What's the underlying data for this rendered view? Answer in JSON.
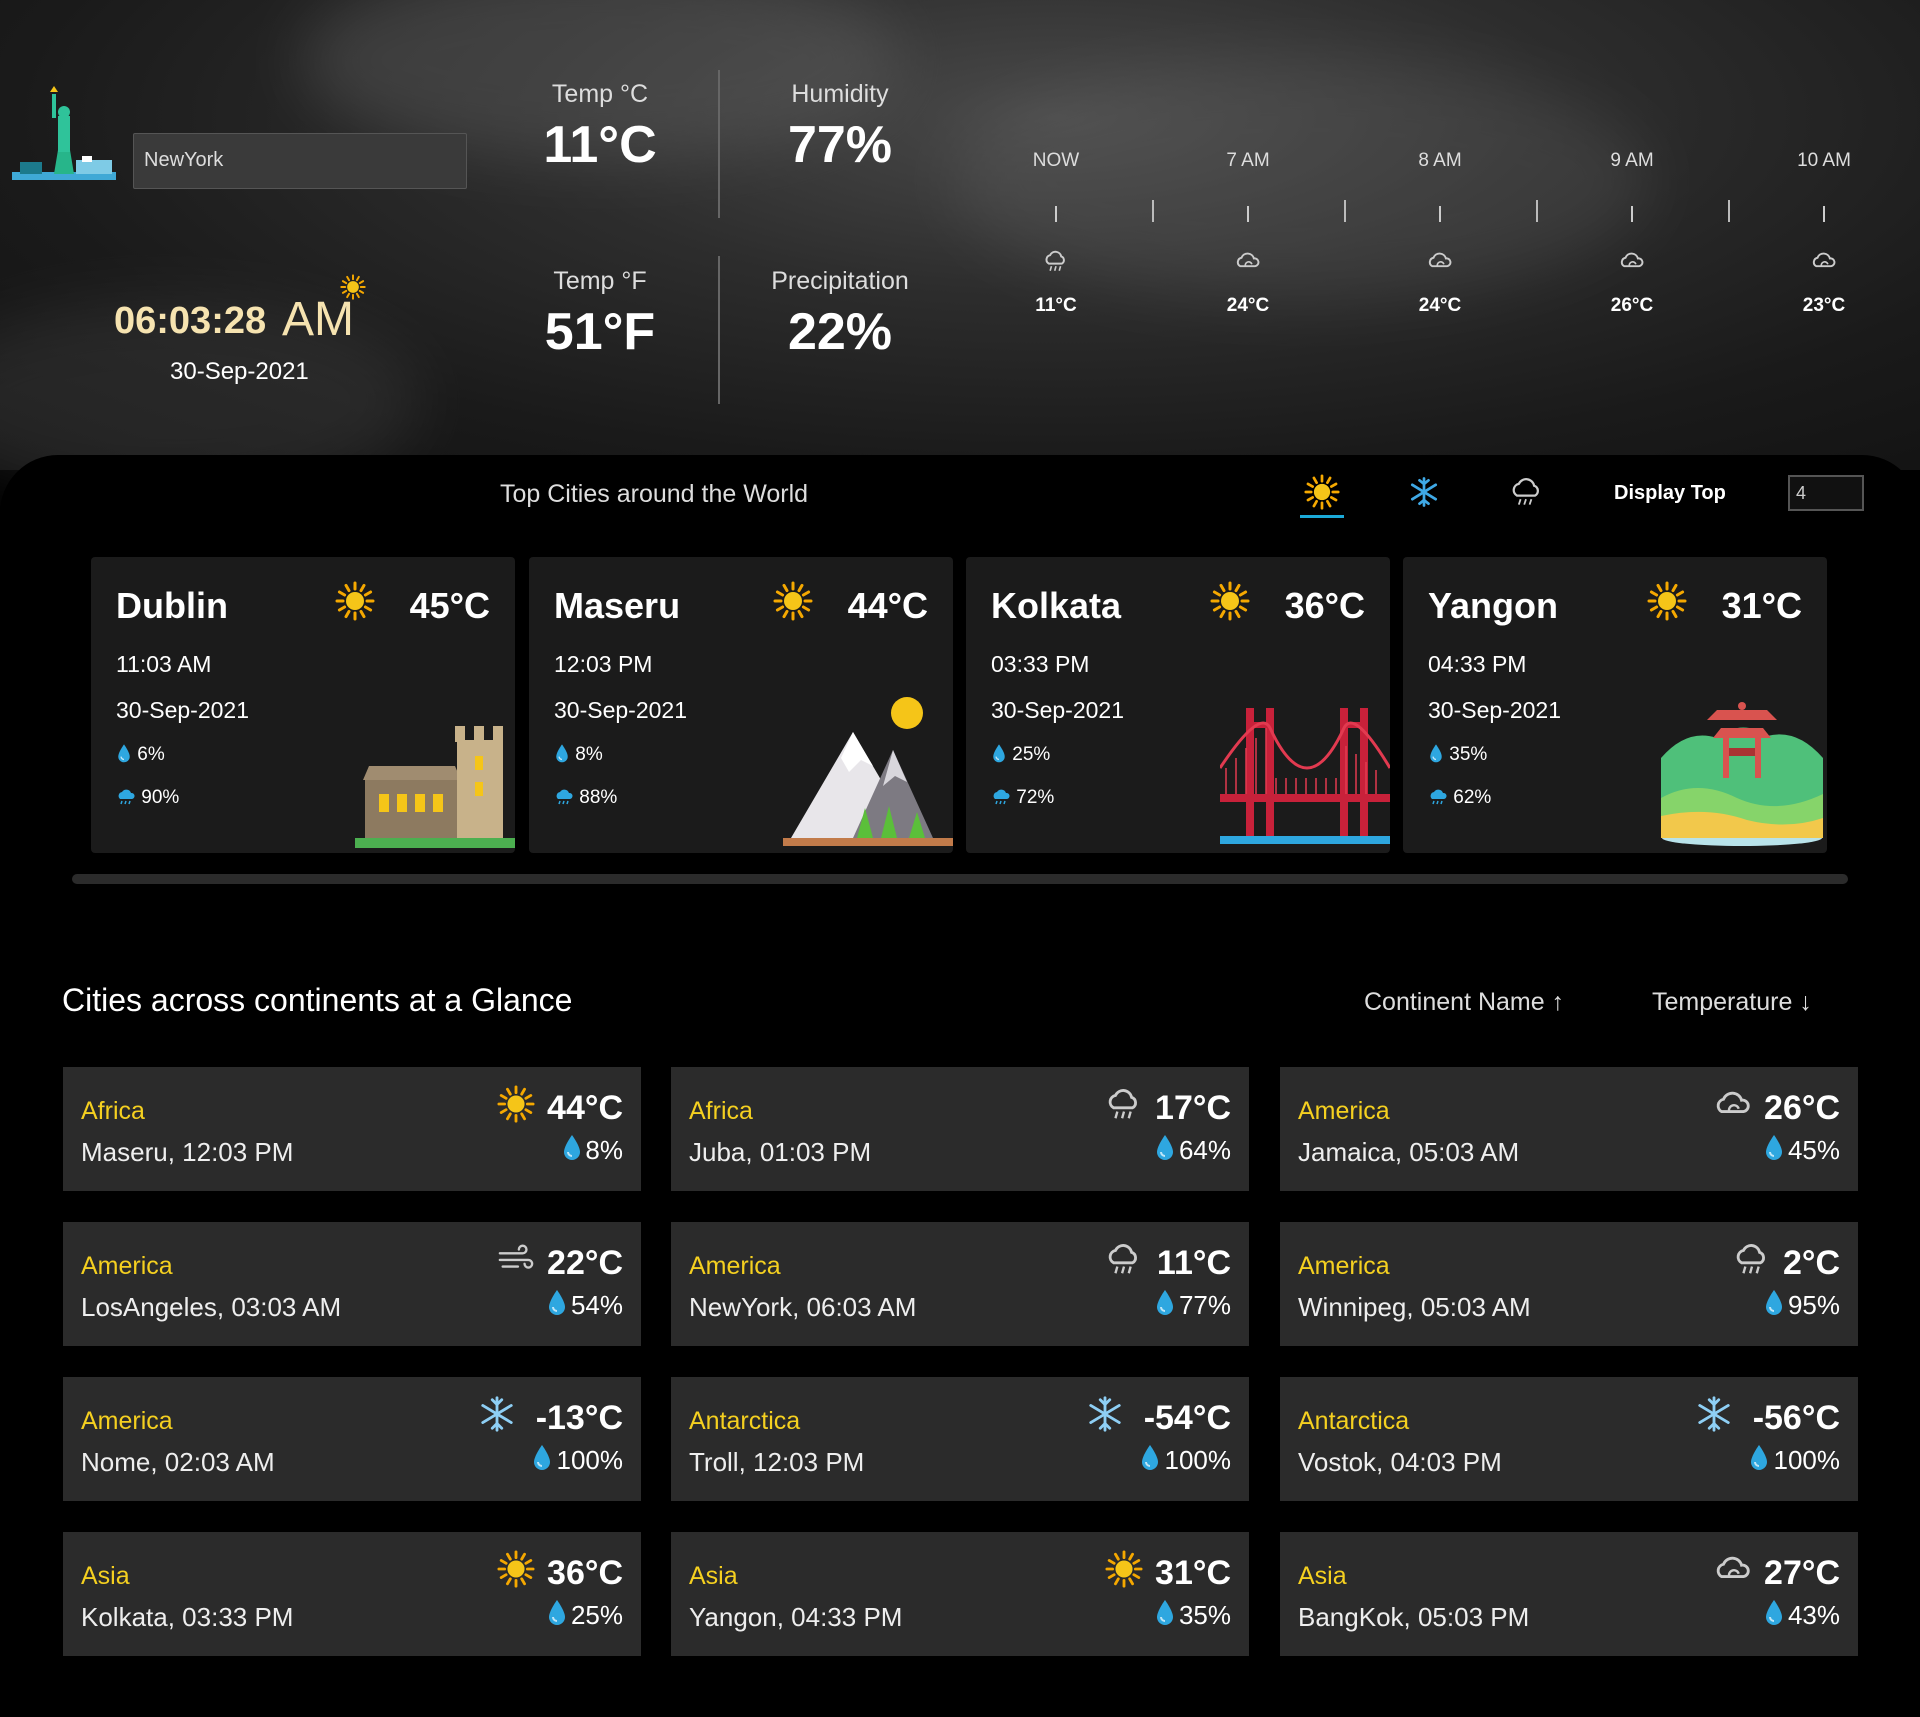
{
  "header": {
    "city_value": "NewYork",
    "clock": "06:03:28",
    "ampm": "AM",
    "date": "30-Sep-2021",
    "temp_c_label": "Temp °C",
    "temp_c_value": "11°C",
    "humidity_label": "Humidity",
    "humidity_value": "77%",
    "temp_f_label": "Temp °F",
    "temp_f_value": "51°F",
    "precip_label": "Precipitation",
    "precip_value": "22%",
    "hourly": [
      {
        "hour": "NOW",
        "temp": "11°C"
      },
      {
        "hour": "7 AM",
        "temp": "24°C"
      },
      {
        "hour": "8 AM",
        "temp": "24°C"
      },
      {
        "hour": "9 AM",
        "temp": "26°C"
      },
      {
        "hour": "10 AM",
        "temp": "23°C"
      }
    ]
  },
  "top_cities": {
    "title": "Top Cities around the World",
    "display_label": "Display Top",
    "display_value": "4",
    "cards": [
      {
        "name": "Dublin",
        "temp": "45°C",
        "time": "11:03 AM",
        "date": "30-Sep-2021",
        "humidity": "6%",
        "precip": "90%",
        "art": "castle"
      },
      {
        "name": "Maseru",
        "temp": "44°C",
        "time": "12:03 PM",
        "date": "30-Sep-2021",
        "humidity": "8%",
        "precip": "88%",
        "art": "mountain"
      },
      {
        "name": "Kolkata",
        "temp": "36°C",
        "time": "03:33 PM",
        "date": "30-Sep-2021",
        "humidity": "25%",
        "precip": "72%",
        "art": "bridge"
      },
      {
        "name": "Yangon",
        "temp": "31°C",
        "time": "04:33 PM",
        "date": "30-Sep-2021",
        "humidity": "35%",
        "precip": "62%",
        "art": "pagoda"
      }
    ]
  },
  "continents": {
    "title": "Cities across continents at a Glance",
    "sort_continent": "Continent Name",
    "sort_temperature": "Temperature",
    "tiles": [
      {
        "continent": "Africa",
        "city": "Maseru, 12:03 PM",
        "temp": "44°C",
        "humidity": "8%",
        "icon": "sun-icon"
      },
      {
        "continent": "Africa",
        "city": "Juba, 01:03 PM",
        "temp": "17°C",
        "humidity": "64%",
        "icon": "rain-cloud-icon"
      },
      {
        "continent": "America",
        "city": "Jamaica, 05:03 AM",
        "temp": "26°C",
        "humidity": "45%",
        "icon": "cloud-icon"
      },
      {
        "continent": "America",
        "city": "LosAngeles, 03:03 AM",
        "temp": "22°C",
        "humidity": "54%",
        "icon": "wind-icon"
      },
      {
        "continent": "America",
        "city": "NewYork, 06:03 AM",
        "temp": "11°C",
        "humidity": "77%",
        "icon": "rain-cloud-icon"
      },
      {
        "continent": "America",
        "city": "Winnipeg, 05:03 AM",
        "temp": "2°C",
        "humidity": "95%",
        "icon": "rain-cloud-icon"
      },
      {
        "continent": "America",
        "city": "Nome, 02:03 AM",
        "temp": "-13°C",
        "humidity": "100%",
        "icon": "snowflake-icon"
      },
      {
        "continent": "Antarctica",
        "city": "Troll, 12:03 PM",
        "temp": "-54°C",
        "humidity": "100%",
        "icon": "snowflake-icon"
      },
      {
        "continent": "Antarctica",
        "city": "Vostok, 04:03 PM",
        "temp": "-56°C",
        "humidity": "100%",
        "icon": "snowflake-icon"
      },
      {
        "continent": "Asia",
        "city": "Kolkata, 03:33 PM",
        "temp": "36°C",
        "humidity": "25%",
        "icon": "sun-icon"
      },
      {
        "continent": "Asia",
        "city": "Yangon, 04:33 PM",
        "temp": "31°C",
        "humidity": "35%",
        "icon": "sun-icon"
      },
      {
        "continent": "Asia",
        "city": "BangKok, 05:03 PM",
        "temp": "27°C",
        "humidity": "43%",
        "icon": "cloud-icon"
      }
    ]
  },
  "colors": {
    "accent": "#1ba9d8",
    "continent": "#f5d020",
    "clock": "#f6e3b0"
  }
}
